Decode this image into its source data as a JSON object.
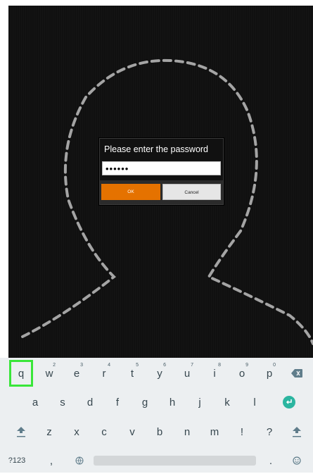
{
  "dialog": {
    "title": "Please enter the password",
    "password_value": "••••••",
    "ok_label": "OK",
    "cancel_label": "Cancel"
  },
  "keyboard": {
    "row1": [
      {
        "key": "q",
        "hint": ""
      },
      {
        "key": "w",
        "hint": "2"
      },
      {
        "key": "e",
        "hint": "3"
      },
      {
        "key": "r",
        "hint": "4"
      },
      {
        "key": "t",
        "hint": "5"
      },
      {
        "key": "y",
        "hint": "6"
      },
      {
        "key": "u",
        "hint": "7"
      },
      {
        "key": "i",
        "hint": "8"
      },
      {
        "key": "o",
        "hint": "9"
      },
      {
        "key": "p",
        "hint": "0"
      }
    ],
    "row2": [
      "a",
      "s",
      "d",
      "f",
      "g",
      "h",
      "j",
      "k",
      "l"
    ],
    "row3": [
      "z",
      "x",
      "c",
      "v",
      "b",
      "n",
      "m",
      "!",
      "?"
    ],
    "symbols_label": "?123",
    "comma_label": ",",
    "period_label": ".",
    "selected_key": "q"
  },
  "colors": {
    "ok_button": "#e57200",
    "selection_outline": "#39e639",
    "enter_key": "#2bb5a0",
    "keyboard_bg": "#eceff1"
  },
  "icons": [
    "backspace-icon",
    "enter-icon",
    "shift-left-icon",
    "shift-right-icon",
    "globe-icon",
    "emoji-icon"
  ]
}
